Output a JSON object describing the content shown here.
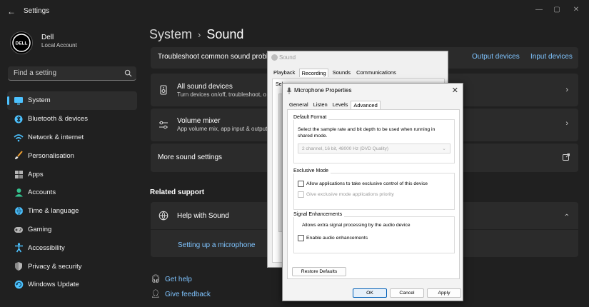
{
  "app": {
    "title": "Settings"
  },
  "user": {
    "name": "Dell",
    "account": "Local Account",
    "avatar_text": "DELL"
  },
  "search": {
    "placeholder": "Find a setting"
  },
  "sidebar": {
    "items": [
      {
        "label": "System",
        "icon": "monitor-icon",
        "color": "#4cc2ff",
        "active": true
      },
      {
        "label": "Bluetooth & devices",
        "icon": "bluetooth-icon",
        "color": "#4cc2ff"
      },
      {
        "label": "Network & internet",
        "icon": "wifi-icon",
        "color": "#4cc2ff"
      },
      {
        "label": "Personalisation",
        "icon": "brush-icon",
        "color": "#f0a030"
      },
      {
        "label": "Apps",
        "icon": "apps-icon",
        "color": "#b5b5b5"
      },
      {
        "label": "Accounts",
        "icon": "person-icon",
        "color": "#35c38f"
      },
      {
        "label": "Time & language",
        "icon": "globe-icon",
        "color": "#4cc2ff"
      },
      {
        "label": "Gaming",
        "icon": "gamepad-icon",
        "color": "#b5b5b5"
      },
      {
        "label": "Accessibility",
        "icon": "accessibility-icon",
        "color": "#4cc2ff"
      },
      {
        "label": "Privacy & security",
        "icon": "shield-icon",
        "color": "#b5b5b5"
      },
      {
        "label": "Windows Update",
        "icon": "update-icon",
        "color": "#4cc2ff"
      }
    ]
  },
  "header": {
    "parent": "System",
    "separator": "›",
    "current": "Sound"
  },
  "troubleshoot": {
    "label": "Troubleshoot common sound problem",
    "output_link": "Output devices",
    "input_link": "Input devices"
  },
  "cards": {
    "all_devices": {
      "title": "All sound devices",
      "subtitle": "Turn devices on/off, troubleshoot, o"
    },
    "volume_mixer": {
      "title": "Volume mixer",
      "subtitle": "App volume mix, app input & output"
    },
    "more_settings": {
      "title": "More sound settings"
    }
  },
  "related": {
    "heading": "Related support",
    "help_title": "Help with Sound",
    "help_link": "Setting up a microphone"
  },
  "footer_links": {
    "get_help": "Get help",
    "give_feedback": "Give feedback"
  },
  "sound_dialog": {
    "title": "Sound",
    "tabs": [
      "Playback",
      "Recording",
      "Sounds",
      "Communications"
    ],
    "selected_tab": "Recording",
    "partial_text": "Sel"
  },
  "mic_dialog": {
    "title": "Microphone Properties",
    "tabs": [
      "General",
      "Listen",
      "Levels",
      "Advanced"
    ],
    "selected_tab": "Advanced",
    "default_format": {
      "heading": "Default Format",
      "description": "Select the sample rate and bit depth to be used when running in shared mode.",
      "value": "2 channel, 16 bit, 48000 Hz (DVD Quality)"
    },
    "exclusive_mode": {
      "heading": "Exclusive Mode",
      "allow_label": "Allow applications to take exclusive control of this device",
      "priority_label": "Give exclusive mode applications priority"
    },
    "signal": {
      "heading": "Signal Enhancements",
      "description": "Allows extra signal processing by the audio device",
      "enable_label": "Enable audio enhancements"
    },
    "buttons": {
      "restore": "Restore Defaults",
      "ok": "OK",
      "cancel": "Cancel",
      "apply": "Apply"
    }
  }
}
